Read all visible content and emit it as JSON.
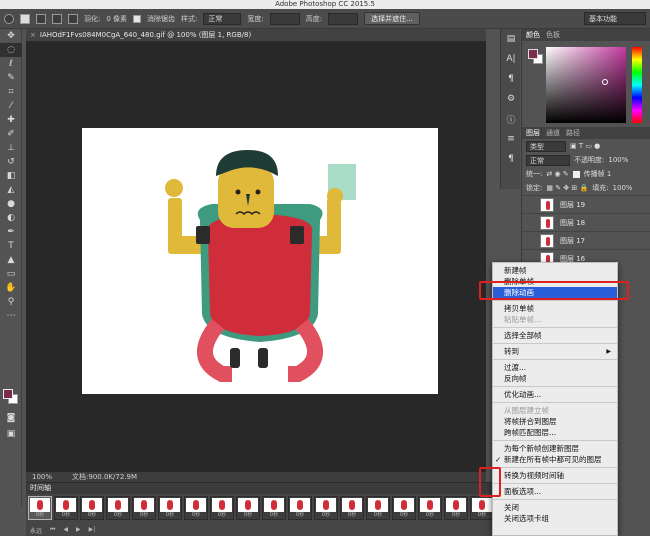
{
  "app": {
    "title": "Adobe Photoshop CC 2015.5"
  },
  "options_bar": {
    "feather_label": "羽化:",
    "feather_value": "0 像素",
    "antialias_label": "消除锯齿",
    "style_label": "样式:",
    "style_value": "正常",
    "width_label": "宽度:",
    "height_label": "高度:",
    "select_mask_button": "选择并遮住...",
    "workspace": "基本功能"
  },
  "document": {
    "tab_title": "IAHOdF1Fvs084M0CgA_640_480.gif @ 100% (图层 1, RGB/8)",
    "zoom": "100%",
    "doc_size": "文档:900.0K/72.9M"
  },
  "right_panels": {
    "color_tabs": [
      "颜色",
      "色板"
    ],
    "layer_tabs": [
      "图层",
      "通道",
      "路径"
    ],
    "kind_filter": "类型",
    "blend_mode": "正常",
    "opacity_label": "不透明度:",
    "opacity_value": "100%",
    "unify_label": "统一:",
    "propagate_label": "传播帧 1",
    "lock_label": "锁定:",
    "fill_label": "填充:",
    "fill_value": "100%",
    "layers": [
      "图层 19",
      "图层 18",
      "图层 17",
      "图层 16"
    ]
  },
  "timeline": {
    "tab_label": "时间轴",
    "loop_label": "永远",
    "frame_times": [
      "0秒",
      "0秒",
      "0秒",
      "0秒",
      "0秒",
      "0秒",
      "0秒",
      "0秒",
      "0秒",
      "0秒",
      "0秒",
      "0秒",
      "0秒",
      "0秒",
      "0秒",
      "0秒",
      "0秒",
      "0秒"
    ]
  },
  "context_menu": {
    "items": [
      {
        "label": "新建帧",
        "state": "normal"
      },
      {
        "label": "删除单帧",
        "state": "normal"
      },
      {
        "label": "删除动画",
        "state": "highlighted"
      },
      {
        "sep": true
      },
      {
        "label": "拷贝单帧",
        "state": "normal"
      },
      {
        "label": "粘贴单帧...",
        "state": "disabled"
      },
      {
        "sep": true
      },
      {
        "label": "选择全部帧",
        "state": "normal"
      },
      {
        "sep": true
      },
      {
        "label": "转到",
        "state": "normal",
        "submenu": true
      },
      {
        "sep": true
      },
      {
        "label": "过渡...",
        "state": "normal"
      },
      {
        "label": "反向帧",
        "state": "normal"
      },
      {
        "sep": true
      },
      {
        "label": "优化动画...",
        "state": "normal"
      },
      {
        "sep": true
      },
      {
        "label": "从图层建立帧",
        "state": "disabled"
      },
      {
        "label": "将帧拼合到图层",
        "state": "normal"
      },
      {
        "label": "跨帧匹配图层...",
        "state": "normal"
      },
      {
        "sep": true
      },
      {
        "label": "为每个新帧创建新图层",
        "state": "normal"
      },
      {
        "label": "新建在所有帧中都可见的图层",
        "state": "checked"
      },
      {
        "sep": true
      },
      {
        "label": "转换为视频时间轴",
        "state": "normal"
      },
      {
        "sep": true
      },
      {
        "label": "面板选项...",
        "state": "normal"
      },
      {
        "sep": true
      },
      {
        "label": "关闭",
        "state": "normal"
      },
      {
        "label": "关闭选项卡组",
        "state": "normal"
      }
    ]
  },
  "colors": {
    "foreground": "#7b2d4e",
    "menu_highlight": "#2b5fd9",
    "annotation": "#e02020",
    "character_skin": "#e0b83a",
    "character_body": "#cf2d3a",
    "character_hair": "#1f3b35",
    "paper": "#a9dcc7"
  }
}
